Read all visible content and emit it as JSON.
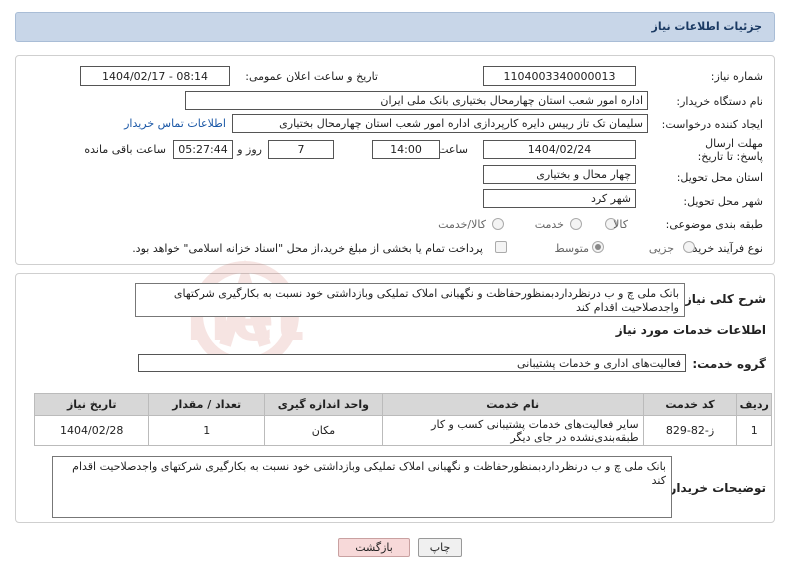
{
  "header": {
    "title": "جزئیات اطلاعات نیاز"
  },
  "fields": {
    "need_number_label": "شماره نیاز:",
    "need_number": "1104003340000013",
    "announce_label": "تاریخ و ساعت اعلان عمومی:",
    "announce_value": "1404/02/17 - 08:14",
    "buyer_org_label": "نام دستگاه خریدار:",
    "buyer_org": "اداره امور شعب استان چهارمحال بختیاری بانک ملی ایران",
    "creator_label": "ایجاد کننده درخواست:",
    "creator": "سلیمان تک تاز رییس دایره کارپردازی  اداره امور شعب استان چهارمحال بختیاری",
    "contact_link": "اطلاعات تماس خریدار",
    "deadline_label": "مهلت ارسال پاسخ: تا تاریخ:",
    "deadline_date": "1404/02/24",
    "time_label": "ساعت",
    "deadline_time": "14:00",
    "days_value": "7",
    "days_label": "روز و",
    "remaining_time": "05:27:44",
    "remaining_label": "ساعت باقی مانده",
    "province_label": "استان محل تحویل:",
    "province": "چهار محال و بختیاری",
    "city_label": "شهر محل تحویل:",
    "city": "شهر کرد",
    "category_label": "طبقه بندی موضوعی:",
    "category_options": [
      "کالا",
      "خدمت",
      "کالا/خدمت"
    ],
    "process_label": "نوع فرآیند خرید :",
    "process_options": [
      "جزیی",
      "متوسط"
    ],
    "payment_note": "پرداخت تمام یا بخشی از مبلغ خرید،از محل \"اسناد خزانه اسلامی\" خواهد بود."
  },
  "summary": {
    "label": "شرح کلی نیاز:",
    "text": "بانک ملی چ و ب درنظرداردبمنظورحفاظت و نگهبانی املاک تملیکی وبازداشتی خود نسبت به بکارگیری شرکتهای واجدصلاحیت اقدام کند"
  },
  "services": {
    "section_title": "اطلاعات خدمات مورد نیاز",
    "group_label": "گروه خدمت:",
    "group_value": "فعالیت‌های اداری و خدمات پشتیبانی",
    "columns": [
      "ردیف",
      "کد خدمت",
      "نام خدمت",
      "واحد اندازه گیری",
      "تعداد / مقدار",
      "تاریخ نیاز"
    ],
    "rows": [
      {
        "row": "1",
        "code": "ز-82-829",
        "name": "سایر فعالیت‌های خدمات پشتیبانی کسب و کار طبقه‌بندی‌نشده در جای دیگر",
        "unit": "مکان",
        "qty": "1",
        "date": "1404/02/28"
      }
    ]
  },
  "buyer_notes": {
    "label": "توضیحات خریدار:",
    "text": "بانک ملی چ و ب درنظرداردبمنظورحفاظت و نگهبانی املاک تملیکی وبازداشتی خود نسبت به بکارگیری شرکتهای واجدصلاحیت اقدام کند"
  },
  "buttons": {
    "print": "چاپ",
    "back": "بازگشت"
  },
  "watermark": {
    "text": "AriaTender.net"
  },
  "colors": {
    "header_bg": "#c8d6e8",
    "link": "#1a57a6",
    "back_btn_bg": "#f7d9d9",
    "watermark": "#c0392b"
  }
}
